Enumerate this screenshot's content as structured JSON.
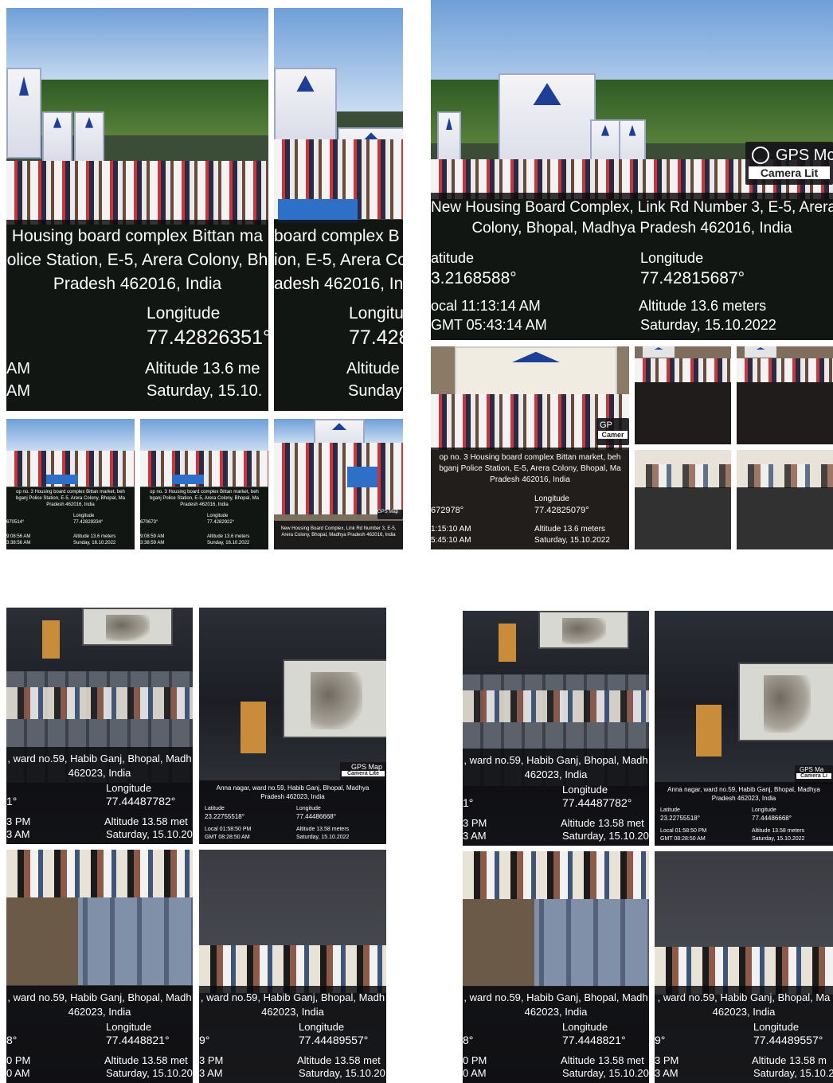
{
  "collage": {
    "p1": {
      "address": "Housing board complex Bittan ma\nolice Station, E-5, Arera Colony, Bh\nPradesh 462016, India",
      "long_label": "Longitude",
      "long_value": "77.42826351°",
      "alt": "Altitude 13.6 me",
      "date": "Saturday, 15.10.",
      "time1": "AM",
      "time2": "AM"
    },
    "p2": {
      "address": "board complex B\nion, E-5, Arera Co\nadesh 462016, In",
      "long_label": "Longitu",
      "long_value": "77.428",
      "alt": "Altitude",
      "date": "Sunday"
    },
    "p3": {
      "address": "New Housing Board Complex, Link Rd Number 3, E-5, Arera\nColony, Bhopal, Madhya Pradesh 462016, India",
      "lat_label": "atitude",
      "lat_value": "3.2168588°",
      "long_label": "Longitude",
      "long_value": "77.42815687°",
      "local": "ocal 11:13:14 AM",
      "gmt": "GMT 05:43:14 AM",
      "alt": "Altitude 13.6 meters",
      "date": "Saturday, 15.10.2022",
      "badge_title": "GPS Mc",
      "badge_sub": "Camera Lit"
    },
    "p4": {
      "address": "op no. 3 Housing board complex Bittan market, beh\nbganj Police Station, E-5, Arera Colony, Bhopal, Ma\nPradesh 462016, India",
      "lat_value": "672978°",
      "long_label": "Longitude",
      "long_value": "77.42825079°",
      "local": "1:15:10 AM",
      "gmt": "5:45:10 AM",
      "alt": "Altitude 13.6 meters",
      "date": "Saturday, 15.10.2022",
      "badge_title": "GP",
      "badge_sub": "Camer"
    },
    "thumb1": {
      "address": "op no. 3 Housing board complex Bittan market, beh\nbganj Police Station, E-5, Arera Colony, Bhopal, Ma\nPradesh 462016, India",
      "lat": "670514°",
      "long_label": "Longitude",
      "long": "77.42829334°",
      "t1": "9:08:56 AM",
      "t2": "3:38:56 AM",
      "alt": "Altitude 13.6 meters",
      "date": "Sunday, 16.10.2022"
    },
    "thumb2": {
      "address": "op no. 3 Housing board complex Bittan market, beh\nbganj Police Station, E-5, Arera Colony, Bhopal, Ma\nPradesh 462016, India",
      "lat": "670673°",
      "long_label": "Longitude",
      "long": "77.4282922°",
      "t1": "9:08:59 AM",
      "t2": "3:38:59 AM",
      "alt": "Altitude 13.6 meters",
      "date": "Sunday, 16.10.2022"
    },
    "thumb3": {
      "address": "New Housing Board Complex, Link Rd Number 3, E-5,\nArera Colony, Bhopal, Madhya Pradesh 462016, India",
      "badge": "GPS Map"
    },
    "q1": {
      "address": ", ward no.59, Habib Ganj, Bhopal, Madh\n462023, India",
      "lat": "1°",
      "long_label": "Longitude",
      "long_value": "77.44487782°",
      "pm": "3 PM",
      "am": "3 AM",
      "alt": "Altitude 13.58 met",
      "date": "Saturday, 15.10.20"
    },
    "q2": {
      "address": "Anna nagar, ward no.59, Habib Ganj, Bhopal, Madhya\nPradesh 462023, India",
      "lat_label": "Latitude",
      "lat_value": "23.22755518°",
      "long_label": "Longitude",
      "long_value": "77.44486668°",
      "local": "Local 01:58:50 PM",
      "gmt": "GMT 08:28:50 AM",
      "alt": "Altitude 13.58 meters",
      "date": "Saturday, 15.10.2022",
      "badge_title": "GPS Map",
      "badge_sub": "Camera Lite"
    },
    "q3": {
      "address": ", ward no.59, Habib Ganj, Bhopal, Madh\n462023, India",
      "lat": "8°",
      "long_label": "Longitude",
      "long_value": "77.4448821°",
      "pm": "0 PM",
      "am": "0 AM",
      "alt": "Altitude 13.58 met",
      "date": "Saturday, 15.10.20"
    },
    "q4": {
      "address": ", ward no.59, Habib Ganj, Bhopal, Madh\n462023, India",
      "lat": "9°",
      "long_label": "Longitude",
      "long_value": "77.44489557°",
      "pm": "3 PM",
      "am": "3 AM",
      "alt": "Altitude 13.58 met",
      "date": "Saturday, 15.10.20"
    },
    "r1": {
      "address": ", ward no.59, Habib Ganj, Bhopal, Madh\n462023, India",
      "lat": "1°",
      "long_label": "Longitude",
      "long_value": "77.44487782°",
      "pm": "3 PM",
      "am": "3 AM",
      "alt": "Altitude 13.58 met",
      "date": "Saturday, 15.10.20"
    },
    "r2": {
      "address": "Anna nagar, ward no.59, Habib Ganj, Bhopal, Madhya\nPradesh 462023, India",
      "lat_label": "Latitude",
      "lat_value": "23.22755518°",
      "long_label": "Longitude",
      "long_value": "77.44486668°",
      "local": "Local 01:58:50 PM",
      "gmt": "GMT 08:28:50 AM",
      "alt": "Altitude 13.58 meters",
      "date": "Saturday, 15.10.2022",
      "badge_title": "GPS Ma",
      "badge_sub": "Camera Li"
    },
    "r3": {
      "address": ", ward no.59, Habib Ganj, Bhopal, Madh\n462023, India",
      "lat": "8°",
      "long_label": "Longitude",
      "long_value": "77.4448821°",
      "pm": "0 PM",
      "am": "0 AM",
      "alt": "Altitude 13.58 met",
      "date": "Saturday, 15.10.20"
    },
    "r4": {
      "address": ", ward no.59, Habib Ganj, Bhopal, Ma\n462023, India",
      "lat": "9°",
      "long_label": "Longitude",
      "long_value": "77.44489557°",
      "pm": "3 PM",
      "am": "3 AM",
      "alt": "Altitude 13.58 m",
      "date": "Saturday, 15.10.2"
    }
  }
}
